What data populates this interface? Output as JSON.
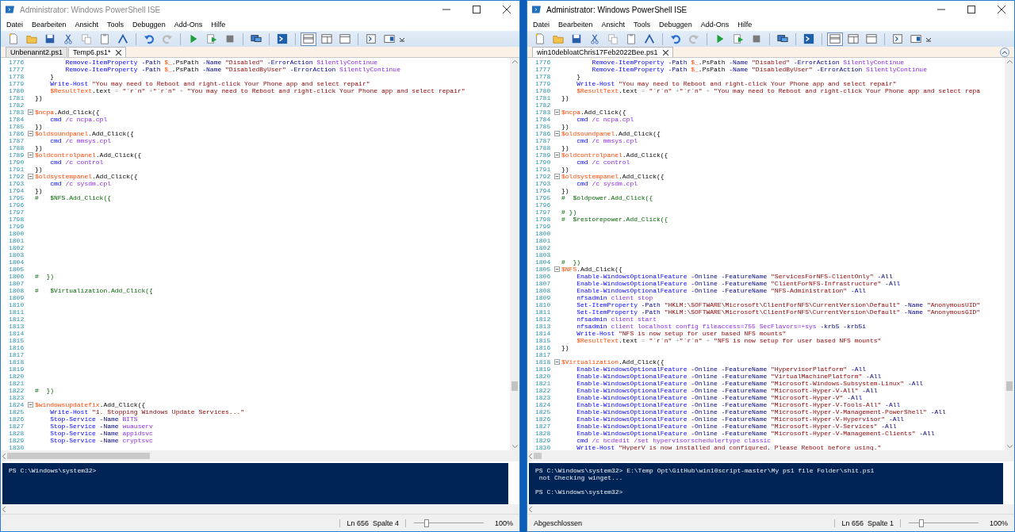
{
  "windows": [
    {
      "title": "Administrator: Windows PowerShell ISE",
      "active": false,
      "menu": [
        "Datei",
        "Bearbeiten",
        "Ansicht",
        "Tools",
        "Debuggen",
        "Add-Ons",
        "Hilfe"
      ],
      "layout_buttons": [
        {
          "selected": true
        },
        {
          "selected": false
        },
        {
          "selected": false
        }
      ],
      "tabs": [
        {
          "label": "Unbenannt2.ps1",
          "selected": false
        },
        {
          "label": "Temp6.ps1*",
          "selected": true
        }
      ],
      "editor": {
        "lines": [
          {
            "n": "1776",
            "fold": false,
            "tokens": [
              {
                "kind": "cmd",
                "text": "        Remove-ItemProperty"
              },
              {
                "kind": "param",
                "text": " -Path"
              },
              {
                "kind": "var",
                "text": " $_"
              },
              {
                "kind": "txt",
                "text": ".PsPath"
              },
              {
                "kind": "param",
                "text": " -Name"
              },
              {
                "kind": "str",
                "text": " \"Disabled\""
              },
              {
                "kind": "param",
                "text": " -ErrorAction"
              },
              {
                "kind": "arg",
                "text": " SilentlyContinue"
              }
            ]
          },
          {
            "n": "1777",
            "fold": false,
            "tokens": [
              {
                "kind": "cmd",
                "text": "        Remove-ItemProperty"
              },
              {
                "kind": "param",
                "text": " -Path"
              },
              {
                "kind": "var",
                "text": " $_"
              },
              {
                "kind": "txt",
                "text": ".PsPath"
              },
              {
                "kind": "param",
                "text": " -Name"
              },
              {
                "kind": "str",
                "text": " \"DisabledByUser\""
              },
              {
                "kind": "param",
                "text": " -ErrorAction"
              },
              {
                "kind": "arg",
                "text": " SilentlyContinue"
              }
            ]
          },
          {
            "n": "1778",
            "fold": false,
            "tokens": [
              {
                "kind": "txt",
                "text": "    }"
              }
            ]
          },
          {
            "n": "1779",
            "fold": false,
            "tokens": [
              {
                "kind": "cmd",
                "text": "    Write-Host"
              },
              {
                "kind": "str",
                "text": " \"You may need to Reboot and right-click Your Phone app and select repair\""
              }
            ]
          },
          {
            "n": "1780",
            "fold": false,
            "tokens": [
              {
                "kind": "var",
                "text": "    $ResultText"
              },
              {
                "kind": "txt",
                "text": ".text"
              },
              {
                "kind": "op",
                "text": " ="
              },
              {
                "kind": "str",
                "text": " \"`r`n\""
              },
              {
                "kind": "op",
                "text": " +"
              },
              {
                "kind": "str",
                "text": "\"`r`n\""
              },
              {
                "kind": "op",
                "text": " +"
              },
              {
                "kind": "str",
                "text": " \"You may need to Reboot and right-click Your Phone app and select repair\""
              }
            ]
          },
          {
            "n": "1781",
            "fold": false,
            "tokens": [
              {
                "kind": "txt",
                "text": "})"
              }
            ]
          },
          {
            "n": "1782",
            "fold": false
          },
          {
            "n": "1783",
            "fold": true,
            "tokens": [
              {
                "kind": "var",
                "text": "$ncpa"
              },
              {
                "kind": "txt",
                "text": ".Add_Click({"
              }
            ]
          },
          {
            "n": "1784",
            "fold": false,
            "tokens": [
              {
                "kind": "cmd",
                "text": "    cmd"
              },
              {
                "kind": "arg",
                "text": " /c ncpa.cpl"
              }
            ]
          },
          {
            "n": "1785",
            "fold": false,
            "tokens": [
              {
                "kind": "txt",
                "text": "})"
              }
            ]
          },
          {
            "n": "1786",
            "fold": true,
            "tokens": [
              {
                "kind": "var",
                "text": "$oldsoundpanel"
              },
              {
                "kind": "txt",
                "text": ".Add_Click({"
              }
            ]
          },
          {
            "n": "1787",
            "fold": false,
            "tokens": [
              {
                "kind": "cmd",
                "text": "    cmd"
              },
              {
                "kind": "arg",
                "text": " /c mmsys.cpl"
              }
            ]
          },
          {
            "n": "1788",
            "fold": false,
            "tokens": [
              {
                "kind": "txt",
                "text": "})"
              }
            ]
          },
          {
            "n": "1789",
            "fold": true,
            "tokens": [
              {
                "kind": "var",
                "text": "$oldcontrolpanel"
              },
              {
                "kind": "txt",
                "text": ".Add_Click({"
              }
            ]
          },
          {
            "n": "1790",
            "fold": false,
            "tokens": [
              {
                "kind": "cmd",
                "text": "    cmd"
              },
              {
                "kind": "arg",
                "text": " /c control"
              }
            ]
          },
          {
            "n": "1791",
            "fold": false,
            "tokens": [
              {
                "kind": "txt",
                "text": "})"
              }
            ]
          },
          {
            "n": "1792",
            "fold": true,
            "tokens": [
              {
                "kind": "var",
                "text": "$oldsystempanel"
              },
              {
                "kind": "txt",
                "text": ".Add_Click({"
              }
            ]
          },
          {
            "n": "1793",
            "fold": false,
            "tokens": [
              {
                "kind": "cmd",
                "text": "    cmd"
              },
              {
                "kind": "arg",
                "text": " /c sysdm.cpl"
              }
            ]
          },
          {
            "n": "1794",
            "fold": false,
            "tokens": [
              {
                "kind": "txt",
                "text": "})"
              }
            ]
          },
          {
            "n": "1795",
            "fold": false,
            "tokens": [
              {
                "kind": "com",
                "text": "#   $NFS.Add_Click({"
              }
            ]
          },
          {
            "n": "1796",
            "fold": false
          },
          {
            "n": "1797",
            "fold": false
          },
          {
            "n": "1798",
            "fold": false
          },
          {
            "n": "1799",
            "fold": false
          },
          {
            "n": "1800",
            "fold": false
          },
          {
            "n": "1801",
            "fold": false
          },
          {
            "n": "1802",
            "fold": false
          },
          {
            "n": "1803",
            "fold": false
          },
          {
            "n": "1804",
            "fold": false
          },
          {
            "n": "1805",
            "fold": false
          },
          {
            "n": "1806",
            "fold": false,
            "tokens": [
              {
                "kind": "com",
                "text": "#  })"
              }
            ]
          },
          {
            "n": "1807",
            "fold": false
          },
          {
            "n": "1808",
            "fold": false,
            "tokens": [
              {
                "kind": "com",
                "text": "#   $Virtualization.Add_Click({"
              }
            ]
          },
          {
            "n": "1809",
            "fold": false
          },
          {
            "n": "1810",
            "fold": false
          },
          {
            "n": "1811",
            "fold": false
          },
          {
            "n": "1812",
            "fold": false
          },
          {
            "n": "1813",
            "fold": false
          },
          {
            "n": "1814",
            "fold": false
          },
          {
            "n": "1815",
            "fold": false
          },
          {
            "n": "1816",
            "fold": false
          },
          {
            "n": "1817",
            "fold": false
          },
          {
            "n": "1818",
            "fold": false
          },
          {
            "n": "1819",
            "fold": false
          },
          {
            "n": "1820",
            "fold": false
          },
          {
            "n": "1821",
            "fold": false
          },
          {
            "n": "1822",
            "fold": false,
            "tokens": [
              {
                "kind": "com",
                "text": "#  })"
              }
            ]
          },
          {
            "n": "1823",
            "fold": false
          },
          {
            "n": "1824",
            "fold": true,
            "tokens": [
              {
                "kind": "var",
                "text": "$windowsupdatefix"
              },
              {
                "kind": "txt",
                "text": ".Add_Click({"
              }
            ]
          },
          {
            "n": "1825",
            "fold": false,
            "tokens": [
              {
                "kind": "cmd",
                "text": "    Write-Host"
              },
              {
                "kind": "str",
                "text": " \"1. Stopping Windows Update Services...\""
              }
            ]
          },
          {
            "n": "1826",
            "fold": false,
            "tokens": [
              {
                "kind": "cmd",
                "text": "    Stop-Service"
              },
              {
                "kind": "param",
                "text": " -Name"
              },
              {
                "kind": "arg",
                "text": " BITS"
              }
            ]
          },
          {
            "n": "1827",
            "fold": false,
            "tokens": [
              {
                "kind": "cmd",
                "text": "    Stop-Service"
              },
              {
                "kind": "param",
                "text": " -Name"
              },
              {
                "kind": "arg",
                "text": " wuauserv"
              }
            ]
          },
          {
            "n": "1828",
            "fold": false,
            "tokens": [
              {
                "kind": "cmd",
                "text": "    Stop-Service"
              },
              {
                "kind": "param",
                "text": " -Name"
              },
              {
                "kind": "arg",
                "text": " appidsvc"
              }
            ]
          },
          {
            "n": "1829",
            "fold": false,
            "tokens": [
              {
                "kind": "cmd",
                "text": "    Stop-Service"
              },
              {
                "kind": "param",
                "text": " -Name"
              },
              {
                "kind": "arg",
                "text": " cryptsvc"
              }
            ]
          },
          {
            "n": "1830",
            "fold": false
          }
        ]
      },
      "console": {
        "lines": [
          {
            "kind": "prompt",
            "text": "PS C:\\Windows\\system32>"
          }
        ]
      },
      "status_bar": {
        "position": "Ln 656  Spalte 4",
        "zoom": {
          "level": 0.18,
          "reading": "100%"
        }
      }
    },
    {
      "title": "Administrator: Windows PowerShell ISE",
      "active": true,
      "menu": [
        "Datei",
        "Bearbeiten",
        "Ansicht",
        "Tools",
        "Debuggen",
        "Add-Ons",
        "Hilfe"
      ],
      "layout_buttons": [
        {
          "selected": true
        },
        {
          "selected": false
        },
        {
          "selected": false
        }
      ],
      "tabs": [
        {
          "label": "win10debloatChris17Feb2022Bee.ps1",
          "selected": true
        }
      ],
      "editor": {
        "lines": [
          {
            "n": "1776",
            "fold": false,
            "tokens": [
              {
                "kind": "cmd",
                "text": "        Remove-ItemProperty"
              },
              {
                "kind": "param",
                "text": " -Path"
              },
              {
                "kind": "var",
                "text": " $_"
              },
              {
                "kind": "txt",
                "text": ".PsPath"
              },
              {
                "kind": "param",
                "text": " -Name"
              },
              {
                "kind": "str",
                "text": " \"Disabled\""
              },
              {
                "kind": "param",
                "text": " -ErrorAction"
              },
              {
                "kind": "arg",
                "text": " SilentlyContinue"
              }
            ]
          },
          {
            "n": "1777",
            "fold": false,
            "tokens": [
              {
                "kind": "cmd",
                "text": "        Remove-ItemProperty"
              },
              {
                "kind": "param",
                "text": " -Path"
              },
              {
                "kind": "var",
                "text": " $_"
              },
              {
                "kind": "txt",
                "text": ".PsPath"
              },
              {
                "kind": "param",
                "text": " -Name"
              },
              {
                "kind": "str",
                "text": " \"DisabledByUser\""
              },
              {
                "kind": "param",
                "text": " -ErrorAction"
              },
              {
                "kind": "arg",
                "text": " SilentlyContinue"
              }
            ]
          },
          {
            "n": "1778",
            "fold": false,
            "tokens": [
              {
                "kind": "txt",
                "text": "    }"
              }
            ]
          },
          {
            "n": "1779",
            "fold": false,
            "tokens": [
              {
                "kind": "cmd",
                "text": "    Write-Host"
              },
              {
                "kind": "str",
                "text": " \"You may need to Reboot and right-click Your Phone app and select repair\""
              }
            ]
          },
          {
            "n": "1780",
            "fold": false,
            "tokens": [
              {
                "kind": "var",
                "text": "    $ResultText"
              },
              {
                "kind": "txt",
                "text": ".text"
              },
              {
                "kind": "op",
                "text": " ="
              },
              {
                "kind": "str",
                "text": " \"`r`n\""
              },
              {
                "kind": "op",
                "text": " +"
              },
              {
                "kind": "str",
                "text": "\"`r`n\""
              },
              {
                "kind": "op",
                "text": " +"
              },
              {
                "kind": "str",
                "text": " \"You may need to Reboot and right-click Your Phone app and select repa"
              }
            ]
          },
          {
            "n": "1781",
            "fold": false,
            "tokens": [
              {
                "kind": "txt",
                "text": "})"
              }
            ]
          },
          {
            "n": "1782",
            "fold": false
          },
          {
            "n": "1783",
            "fold": true,
            "tokens": [
              {
                "kind": "var",
                "text": "$ncpa"
              },
              {
                "kind": "txt",
                "text": ".Add_Click({"
              }
            ]
          },
          {
            "n": "1784",
            "fold": false,
            "tokens": [
              {
                "kind": "cmd",
                "text": "    cmd"
              },
              {
                "kind": "arg",
                "text": " /c ncpa.cpl"
              }
            ]
          },
          {
            "n": "1785",
            "fold": false,
            "tokens": [
              {
                "kind": "txt",
                "text": "})"
              }
            ]
          },
          {
            "n": "1786",
            "fold": true,
            "tokens": [
              {
                "kind": "var",
                "text": "$oldsoundpanel"
              },
              {
                "kind": "txt",
                "text": ".Add_Click({"
              }
            ]
          },
          {
            "n": "1787",
            "fold": false,
            "tokens": [
              {
                "kind": "cmd",
                "text": "    cmd"
              },
              {
                "kind": "arg",
                "text": " /c mmsys.cpl"
              }
            ]
          },
          {
            "n": "1788",
            "fold": false,
            "tokens": [
              {
                "kind": "txt",
                "text": "})"
              }
            ]
          },
          {
            "n": "1789",
            "fold": true,
            "tokens": [
              {
                "kind": "var",
                "text": "$oldcontrolpanel"
              },
              {
                "kind": "txt",
                "text": ".Add_Click({"
              }
            ]
          },
          {
            "n": "1790",
            "fold": false,
            "tokens": [
              {
                "kind": "cmd",
                "text": "    cmd"
              },
              {
                "kind": "arg",
                "text": " /c control"
              }
            ]
          },
          {
            "n": "1791",
            "fold": false,
            "tokens": [
              {
                "kind": "txt",
                "text": "})"
              }
            ]
          },
          {
            "n": "1792",
            "fold": true,
            "tokens": [
              {
                "kind": "var",
                "text": "$oldsystempanel"
              },
              {
                "kind": "txt",
                "text": ".Add_Click({"
              }
            ]
          },
          {
            "n": "1793",
            "fold": false,
            "tokens": [
              {
                "kind": "cmd",
                "text": "    cmd"
              },
              {
                "kind": "arg",
                "text": " /c sysdm.cpl"
              }
            ]
          },
          {
            "n": "1794",
            "fold": false,
            "tokens": [
              {
                "kind": "txt",
                "text": "})"
              }
            ]
          },
          {
            "n": "1795",
            "fold": false,
            "tokens": [
              {
                "kind": "com",
                "text": "#  $oldpower.Add_Click({"
              }
            ]
          },
          {
            "n": "1796",
            "fold": false
          },
          {
            "n": "1797",
            "fold": false,
            "tokens": [
              {
                "kind": "com",
                "text": "# })"
              }
            ]
          },
          {
            "n": "1798",
            "fold": false,
            "tokens": [
              {
                "kind": "com",
                "text": "#  $restorepower.Add_Click({"
              }
            ]
          },
          {
            "n": "1799",
            "fold": false
          },
          {
            "n": "1800",
            "fold": false
          },
          {
            "n": "1801",
            "fold": false
          },
          {
            "n": "1802",
            "fold": false
          },
          {
            "n": "1803",
            "fold": false
          },
          {
            "n": "1804",
            "fold": false,
            "tokens": [
              {
                "kind": "com",
                "text": "#  })"
              }
            ]
          },
          {
            "n": "1805",
            "fold": true,
            "tokens": [
              {
                "kind": "var",
                "text": "$NFS"
              },
              {
                "kind": "txt",
                "text": ".Add_Click({"
              }
            ]
          },
          {
            "n": "1806",
            "fold": false,
            "tokens": [
              {
                "kind": "cmd",
                "text": "    Enable-WindowsOptionalFeature"
              },
              {
                "kind": "param",
                "text": " -Online -FeatureName"
              },
              {
                "kind": "str",
                "text": " \"ServicesForNFS-ClientOnly\""
              },
              {
                "kind": "param",
                "text": " -All"
              }
            ]
          },
          {
            "n": "1807",
            "fold": false,
            "tokens": [
              {
                "kind": "cmd",
                "text": "    Enable-WindowsOptionalFeature"
              },
              {
                "kind": "param",
                "text": " -Online -FeatureName"
              },
              {
                "kind": "str",
                "text": " \"ClientForNFS-Infrastructure\""
              },
              {
                "kind": "param",
                "text": " -All"
              }
            ]
          },
          {
            "n": "1808",
            "fold": false,
            "tokens": [
              {
                "kind": "cmd",
                "text": "    Enable-WindowsOptionalFeature"
              },
              {
                "kind": "param",
                "text": " -Online -FeatureName"
              },
              {
                "kind": "str",
                "text": " \"NFS-Administration\""
              },
              {
                "kind": "param",
                "text": " -All"
              }
            ]
          },
          {
            "n": "1809",
            "fold": false,
            "tokens": [
              {
                "kind": "cmd",
                "text": "    nfsadmin"
              },
              {
                "kind": "arg",
                "text": " client stop"
              }
            ]
          },
          {
            "n": "1810",
            "fold": false,
            "tokens": [
              {
                "kind": "cmd",
                "text": "    Set-ItemProperty"
              },
              {
                "kind": "param",
                "text": " -Path"
              },
              {
                "kind": "str",
                "text": " \"HKLM:\\SOFTWARE\\Microsoft\\ClientForNFS\\CurrentVersion\\Default\""
              },
              {
                "kind": "param",
                "text": " -Name"
              },
              {
                "kind": "str",
                "text": " \"AnonymousUID\""
              }
            ]
          },
          {
            "n": "1811",
            "fold": false,
            "tokens": [
              {
                "kind": "cmd",
                "text": "    Set-ItemProperty"
              },
              {
                "kind": "param",
                "text": " -Path"
              },
              {
                "kind": "str",
                "text": " \"HKLM:\\SOFTWARE\\Microsoft\\ClientForNFS\\CurrentVersion\\Default\""
              },
              {
                "kind": "param",
                "text": " -Name"
              },
              {
                "kind": "str",
                "text": " \"AnonymousGID\""
              }
            ]
          },
          {
            "n": "1812",
            "fold": false,
            "tokens": [
              {
                "kind": "cmd",
                "text": "    nfsadmin"
              },
              {
                "kind": "arg",
                "text": " client start"
              }
            ]
          },
          {
            "n": "1813",
            "fold": false,
            "tokens": [
              {
                "kind": "cmd",
                "text": "    nfsadmin"
              },
              {
                "kind": "arg",
                "text": " client localhost config fileaccess=755 SecFlavors=+sys"
              },
              {
                "kind": "param",
                "text": " -krb5 -krb5i"
              }
            ]
          },
          {
            "n": "1814",
            "fold": false,
            "tokens": [
              {
                "kind": "cmd",
                "text": "    Write-Host"
              },
              {
                "kind": "str",
                "text": " \"NFS is now setup for user based NFS mounts\""
              }
            ]
          },
          {
            "n": "1815",
            "fold": false,
            "tokens": [
              {
                "kind": "var",
                "text": "    $ResultText"
              },
              {
                "kind": "txt",
                "text": ".text"
              },
              {
                "kind": "op",
                "text": " ="
              },
              {
                "kind": "str",
                "text": " \"`r`n\""
              },
              {
                "kind": "op",
                "text": " +"
              },
              {
                "kind": "str",
                "text": "\"`r`n\""
              },
              {
                "kind": "op",
                "text": " +"
              },
              {
                "kind": "str",
                "text": " \"NFS is now setup for user based NFS mounts\""
              }
            ]
          },
          {
            "n": "1816",
            "fold": false,
            "tokens": [
              {
                "kind": "txt",
                "text": "})"
              }
            ]
          },
          {
            "n": "1817",
            "fold": false
          },
          {
            "n": "1818",
            "fold": true,
            "tokens": [
              {
                "kind": "var",
                "text": "$Virtualization"
              },
              {
                "kind": "txt",
                "text": ".Add_Click({"
              }
            ]
          },
          {
            "n": "1819",
            "fold": false,
            "tokens": [
              {
                "kind": "cmd",
                "text": "    Enable-WindowsOptionalFeature"
              },
              {
                "kind": "param",
                "text": " -Online -FeatureName"
              },
              {
                "kind": "str",
                "text": " \"HypervisorPlatform\""
              },
              {
                "kind": "param",
                "text": " -All"
              }
            ]
          },
          {
            "n": "1820",
            "fold": false,
            "tokens": [
              {
                "kind": "cmd",
                "text": "    Enable-WindowsOptionalFeature"
              },
              {
                "kind": "param",
                "text": " -Online -FeatureName"
              },
              {
                "kind": "str",
                "text": " \"VirtualMachinePlatform\""
              },
              {
                "kind": "param",
                "text": " -All"
              }
            ]
          },
          {
            "n": "1821",
            "fold": false,
            "tokens": [
              {
                "kind": "cmd",
                "text": "    Enable-WindowsOptionalFeature"
              },
              {
                "kind": "param",
                "text": " -Online -FeatureName"
              },
              {
                "kind": "str",
                "text": " \"Microsoft-Windows-Subsystem-Linux\""
              },
              {
                "kind": "param",
                "text": " -All"
              }
            ]
          },
          {
            "n": "1822",
            "fold": false,
            "tokens": [
              {
                "kind": "cmd",
                "text": "    Enable-WindowsOptionalFeature"
              },
              {
                "kind": "param",
                "text": " -Online -FeatureName"
              },
              {
                "kind": "str",
                "text": " \"Microsoft-Hyper-V-All\""
              },
              {
                "kind": "param",
                "text": " -All"
              }
            ]
          },
          {
            "n": "1823",
            "fold": false,
            "tokens": [
              {
                "kind": "cmd",
                "text": "    Enable-WindowsOptionalFeature"
              },
              {
                "kind": "param",
                "text": " -Online -FeatureName"
              },
              {
                "kind": "str",
                "text": " \"Microsoft-Hyper-V\""
              },
              {
                "kind": "param",
                "text": " -All"
              }
            ]
          },
          {
            "n": "1824",
            "fold": false,
            "tokens": [
              {
                "kind": "cmd",
                "text": "    Enable-WindowsOptionalFeature"
              },
              {
                "kind": "param",
                "text": " -Online -FeatureName"
              },
              {
                "kind": "str",
                "text": " \"Microsoft-Hyper-V-Tools-All\""
              },
              {
                "kind": "param",
                "text": " -All"
              }
            ]
          },
          {
            "n": "1825",
            "fold": false,
            "tokens": [
              {
                "kind": "cmd",
                "text": "    Enable-WindowsOptionalFeature"
              },
              {
                "kind": "param",
                "text": " -Online -FeatureName"
              },
              {
                "kind": "str",
                "text": " \"Microsoft-Hyper-V-Management-PowerShell\""
              },
              {
                "kind": "param",
                "text": " -All"
              }
            ]
          },
          {
            "n": "1826",
            "fold": false,
            "tokens": [
              {
                "kind": "cmd",
                "text": "    Enable-WindowsOptionalFeature"
              },
              {
                "kind": "param",
                "text": " -Online -FeatureName"
              },
              {
                "kind": "str",
                "text": " \"Microsoft-Hyper-V-Hypervisor\""
              },
              {
                "kind": "param",
                "text": " -All"
              }
            ]
          },
          {
            "n": "1827",
            "fold": false,
            "tokens": [
              {
                "kind": "cmd",
                "text": "    Enable-WindowsOptionalFeature"
              },
              {
                "kind": "param",
                "text": " -Online -FeatureName"
              },
              {
                "kind": "str",
                "text": " \"Microsoft-Hyper-V-Services\""
              },
              {
                "kind": "param",
                "text": " -All"
              }
            ]
          },
          {
            "n": "1828",
            "fold": false,
            "tokens": [
              {
                "kind": "cmd",
                "text": "    Enable-WindowsOptionalFeature"
              },
              {
                "kind": "param",
                "text": " -Online -FeatureName"
              },
              {
                "kind": "str",
                "text": " \"Microsoft-Hyper-V-Management-Clients\""
              },
              {
                "kind": "param",
                "text": " -All"
              }
            ]
          },
          {
            "n": "1829",
            "fold": false,
            "tokens": [
              {
                "kind": "cmd",
                "text": "    cmd"
              },
              {
                "kind": "arg",
                "text": " /c bcdedit /set hypervisorschedulertype classic"
              }
            ]
          },
          {
            "n": "1830",
            "fold": false,
            "tokens": [
              {
                "kind": "cmd",
                "text": "    Write-Host"
              },
              {
                "kind": "str",
                "text": " \"HyperV is now installed and configured. Please Reboot before using.\""
              }
            ]
          }
        ]
      },
      "console": {
        "lines": [
          {
            "kind": "prompt",
            "text": "PS C:\\Windows\\system32> E:\\Temp Opt\\GitHub\\win10script-master\\My ps1 file Folder\\shit.ps1"
          },
          {
            "kind": "output",
            "text": " not Checking winget..."
          },
          {
            "kind": "prompt",
            "text": "PS C:\\Windows\\system32>"
          }
        ]
      },
      "status_bar": {
        "status": "Abgeschlossen",
        "position": "Ln 656  Spalte 1",
        "zoom": {
          "level": 0.18,
          "reading": "100%"
        }
      }
    }
  ]
}
